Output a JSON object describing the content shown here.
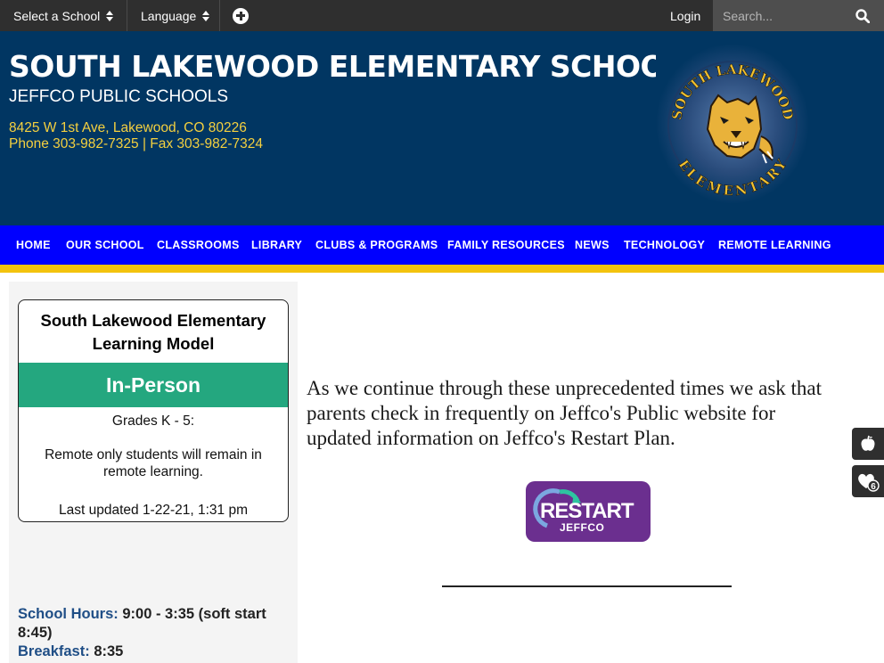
{
  "topbar": {
    "select_school": "Select a School",
    "language": "Language",
    "login": "Login",
    "search_placeholder": "Search..."
  },
  "header": {
    "school_name": "SOUTH LAKEWOOD ELEMENTARY SCHOOL",
    "district": "JEFFCO PUBLIC SCHOOLS",
    "address": "8425 W 1st Ave, Lakewood, CO 80226",
    "phone": "Phone 303-982-7325 | Fax 303-982-7324",
    "logo": {
      "top_text": "SOUTH LAKEWOOD",
      "bottom_text": "ELEMENTARY"
    }
  },
  "nav": {
    "items": [
      {
        "label": "HOME"
      },
      {
        "label": "OUR SCHOOL"
      },
      {
        "label": "CLASSROOMS"
      },
      {
        "label": "LIBRARY"
      },
      {
        "label": "CLUBS & PROGRAMS"
      },
      {
        "label": "FAMILY RESOURCES"
      },
      {
        "label": "NEWS"
      },
      {
        "label": "TECHNOLOGY"
      },
      {
        "label": "REMOTE LEARNING"
      }
    ]
  },
  "learning_model": {
    "title_line1": "South Lakewood Elementary",
    "title_line2": "Learning Model",
    "status": "In-Person",
    "grades": "Grades K - 5:",
    "note_line1": "Remote only students will remain in",
    "note_line2": "remote learning.",
    "updated": "Last updated 1-22-21, 1:31 pm"
  },
  "hours": {
    "school_hours_label": "School Hours:",
    "school_hours_value": "9:00 - 3:35  (soft start",
    "school_hours_value2": "8:45)",
    "breakfast_label": "Breakfast:",
    "breakfast_value": "8:35"
  },
  "main": {
    "line1": "As we continue through these unprecedented times we ask that",
    "line2": "parents check in frequently on Jeffco's Public website for",
    "line3": "updated information on Jeffco's Restart Plan.",
    "restart_word": "RESTART",
    "restart_sub": "JEFFCO"
  },
  "widgets": {
    "badge_count": "6"
  },
  "colors": {
    "topbar": "#2f2f2f",
    "header": "#013662",
    "nav": "#0000ff",
    "nav_accent": "#f3c30e",
    "address_text": "#f4d03f",
    "in_person": "#24a77f",
    "restart_purple": "#6b2f8f",
    "link_label": "#1f4e86"
  }
}
